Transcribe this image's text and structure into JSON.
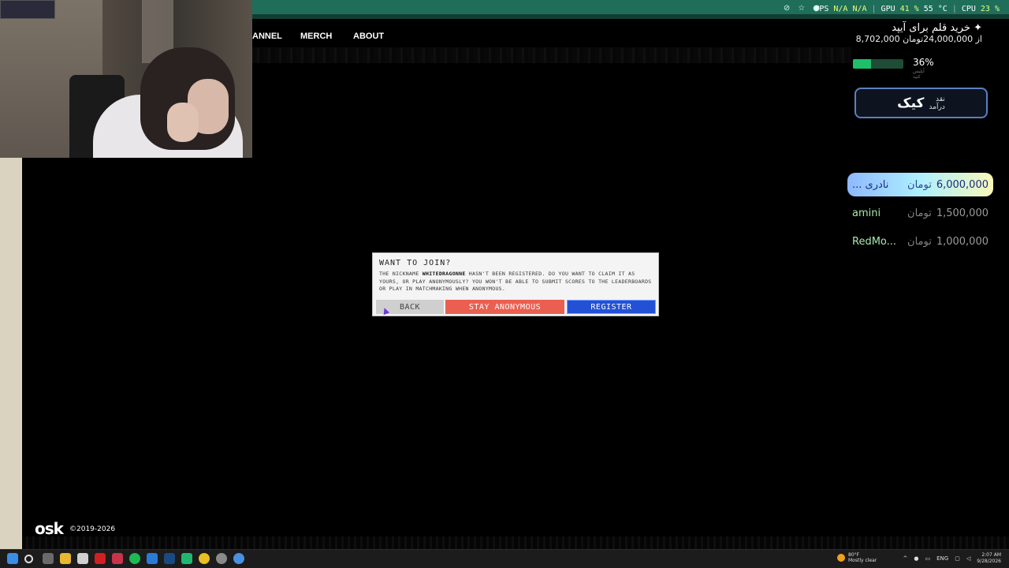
{
  "hud": {
    "fps_label": "FPS",
    "fps_value": "N/A",
    "fps_extra": "N/A",
    "gpu_label": "GPU",
    "gpu_value": "41 %",
    "gpu_temp": "55 °C",
    "cpu_label": "CPU",
    "cpu_value": "23 %"
  },
  "nav": {
    "channel": "ANNEL",
    "merch": "MERCH",
    "about": "ABOUT"
  },
  "donation_goal": {
    "title": "خرید قلم برای آیپد",
    "amount": "8,702,000 از 24,000,000تومان",
    "percent": "36%",
    "percent_value": 36,
    "progress_sub": "آپلیس کنید"
  },
  "kick_card": {
    "brand": "کیک",
    "label_1": "نقد",
    "label_2": "درآمد"
  },
  "leaderboard": [
    {
      "name": "... نادری",
      "currency": "تومان",
      "amount": "6,000,000"
    },
    {
      "name": "amini",
      "currency": "تومان",
      "amount": "1,500,000"
    },
    {
      "name": "RedMo...",
      "currency": "تومان",
      "amount": "1,000,000"
    }
  ],
  "modal": {
    "title": "WANT TO JOIN?",
    "body_pre": "THE NICKNAME ",
    "nickname": "WHITEDRAGONNE",
    "body_post": " HASN'T BEEN REGISTERED. DO YOU WANT TO CLAIM IT AS YOURS, OR PLAY ANONYMOUSLY? YOU WON'T BE ABLE TO SUBMIT SCORES TO THE LEADERBOARDS OR PLAY IN MATCHMAKING WHEN ANONYMOUS.",
    "back_label": "BACK",
    "anon_label": "STAY ANONYMOUS",
    "register_label": "REGISTER"
  },
  "footer": {
    "logo": "osk",
    "copyright": "©2019-2026"
  },
  "taskbar": {
    "weather_temp": "80°F",
    "weather_desc": "Mostly clear",
    "lang": "ENG",
    "time": "2:07 AM",
    "date": "9/28/2026"
  },
  "colors": {
    "register": "#2351d6",
    "anonymous": "#ea5f4f",
    "back": "#cfcfcf",
    "progress": "#1fbf6a",
    "chrome": "#1f6e5a"
  }
}
